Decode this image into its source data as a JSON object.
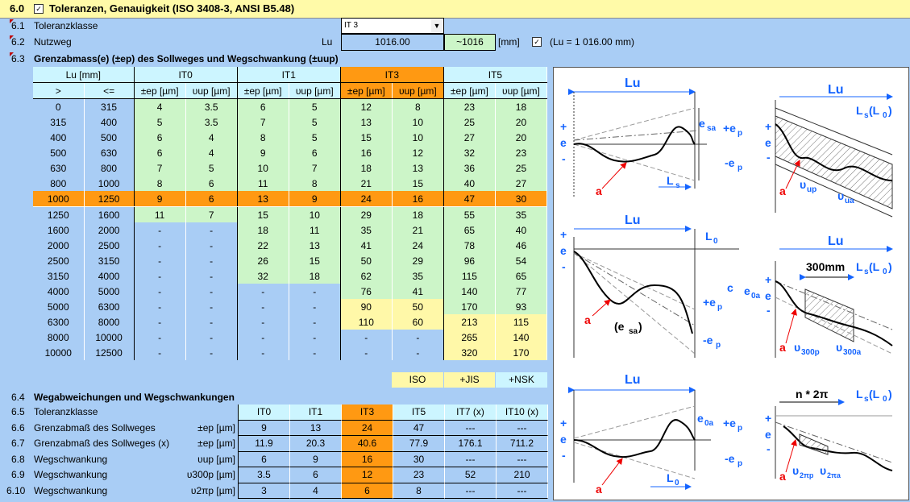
{
  "header": {
    "num": "6.0",
    "title": "Toleranzen, Genauigkeit (ISO 3408-3, ANSI B5.48)",
    "checked": true
  },
  "r61": {
    "num": "6.1",
    "label": "Toleranzklasse",
    "select_value": "IT 3"
  },
  "r62": {
    "num": "6.2",
    "label": "Nutzweg",
    "lu_label": "Lu",
    "lu_value": "1016.00",
    "lu_approx": "~1016",
    "unit": "[mm]",
    "note": "(Lu = 1 016.00 mm)",
    "checked": true
  },
  "r63": {
    "num": "6.3",
    "title": "Grenzabmass(e) (±ep) des Sollweges und Wegschwankung (±uup)"
  },
  "table1": {
    "lu_header": "Lu [mm]",
    "gt": ">",
    "le": "<=",
    "classes": [
      "IT0",
      "IT1",
      "IT3",
      "IT5"
    ],
    "subheaders": [
      "±ep [µm]",
      "υup [µm]",
      "±ep [µm]",
      "υup [µm]",
      "±ep [µm]",
      "υup [µm]",
      "±ep [µm]",
      "υup [µm]"
    ],
    "rows": [
      [
        "0",
        "315",
        "4",
        "3.5",
        "6",
        "5",
        "12",
        "8",
        "23",
        "18"
      ],
      [
        "315",
        "400",
        "5",
        "3.5",
        "7",
        "5",
        "13",
        "10",
        "25",
        "20"
      ],
      [
        "400",
        "500",
        "6",
        "4",
        "8",
        "5",
        "15",
        "10",
        "27",
        "20"
      ],
      [
        "500",
        "630",
        "6",
        "4",
        "9",
        "6",
        "16",
        "12",
        "32",
        "23"
      ],
      [
        "630",
        "800",
        "7",
        "5",
        "10",
        "7",
        "18",
        "13",
        "36",
        "25"
      ],
      [
        "800",
        "1000",
        "8",
        "6",
        "11",
        "8",
        "21",
        "15",
        "40",
        "27"
      ],
      [
        "1000",
        "1250",
        "9",
        "6",
        "13",
        "9",
        "24",
        "16",
        "47",
        "30"
      ],
      [
        "1250",
        "1600",
        "11",
        "7",
        "15",
        "10",
        "29",
        "18",
        "55",
        "35"
      ],
      [
        "1600",
        "2000",
        "-",
        "-",
        "18",
        "11",
        "35",
        "21",
        "65",
        "40"
      ],
      [
        "2000",
        "2500",
        "-",
        "-",
        "22",
        "13",
        "41",
        "24",
        "78",
        "46"
      ],
      [
        "2500",
        "3150",
        "-",
        "-",
        "26",
        "15",
        "50",
        "29",
        "96",
        "54"
      ],
      [
        "3150",
        "4000",
        "-",
        "-",
        "32",
        "18",
        "62",
        "35",
        "115",
        "65"
      ],
      [
        "4000",
        "5000",
        "-",
        "-",
        "-",
        "-",
        "76",
        "41",
        "140",
        "77"
      ],
      [
        "5000",
        "6300",
        "-",
        "-",
        "-",
        "-",
        "90",
        "50",
        "170",
        "93"
      ],
      [
        "6300",
        "8000",
        "-",
        "-",
        "-",
        "-",
        "110",
        "60",
        "213",
        "115"
      ],
      [
        "8000",
        "10000",
        "-",
        "-",
        "-",
        "-",
        "-",
        "-",
        "265",
        "140"
      ],
      [
        "10000",
        "12500",
        "-",
        "-",
        "-",
        "-",
        "-",
        "-",
        "320",
        "170"
      ]
    ],
    "footer": [
      "ISO",
      "+JIS",
      "+NSK"
    ]
  },
  "r64": {
    "num": "6.4",
    "title": "Wegabweichungen und Wegschwankungen"
  },
  "table2": {
    "rows": [
      {
        "num": "6.5",
        "label": "Toleranzklasse",
        "unit": "",
        "cells": [
          "IT0",
          "IT1",
          "IT3",
          "IT5",
          "IT7 (x)",
          "IT10 (x)"
        ]
      },
      {
        "num": "6.6",
        "label": "Grenzabmaß des Sollweges",
        "unit": "±ep [µm]",
        "cells": [
          "9",
          "13",
          "24",
          "47",
          "---",
          "---"
        ]
      },
      {
        "num": "6.7",
        "label": "Grenzabmaß des Sollweges (x)",
        "unit": "±ep [µm]",
        "cells": [
          "11.9",
          "20.3",
          "40.6",
          "77.9",
          "176.1",
          "711.2"
        ]
      },
      {
        "num": "6.8",
        "label": "Wegschwankung",
        "unit": "υup [µm]",
        "cells": [
          "6",
          "9",
          "16",
          "30",
          "---",
          "---"
        ]
      },
      {
        "num": "6.9",
        "label": "Wegschwankung",
        "unit": "υ300p [µm]",
        "cells": [
          "3.5",
          "6",
          "12",
          "23",
          "52",
          "210"
        ]
      },
      {
        "num": "6.10",
        "label": "Wegschwankung",
        "unit": "υ2πp [µm]",
        "cells": [
          "3",
          "4",
          "6",
          "8",
          "---",
          "---"
        ]
      }
    ]
  },
  "diagrams": {
    "lu": "Lu",
    "plus": "+",
    "e": "e",
    "minus": "-",
    "a": "a",
    "esa": "e",
    "esa_sub": "sa",
    "ep_plus": "+e",
    "ep_minus": "-e",
    "p_sub": "p",
    "ls": "L",
    "ls_sub": "s",
    "lsl0": "L",
    "lsl0_tail": "(L",
    "l0": "L",
    "zero": "0",
    "c": "c",
    "e0a": "e",
    "e0a_sub": "0a",
    "esa_paren": "(e",
    "esa_paren_tail": ")",
    "vup": "υ",
    "vup_sub": "up",
    "vua_sub": "ua",
    "mm300": "300mm",
    "v300p_sub": "300p",
    "v300a_sub": "300a",
    "n2pi": "n * 2π",
    "v2pip_sub": "2πp",
    "v2pia_sub": "2πa"
  }
}
